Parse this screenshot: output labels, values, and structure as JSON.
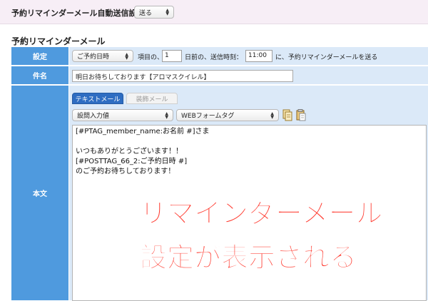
{
  "top": {
    "label": "予約リマインダーメール自動送信設定：",
    "select_value": "送る"
  },
  "section_title": "予約リマインダーメール",
  "rows": {
    "settings": {
      "label": "設定",
      "base_select": "ご予約日時",
      "text_before_days": "項目の、",
      "days_value": "1",
      "text_days_before": "日前の、送信時刻：",
      "time_value": "11:00",
      "text_after": "に、予約リマインダーメールを送る"
    },
    "subject": {
      "label": "件名",
      "value": "明日お待ちしております【アロマスクイレル】"
    },
    "body": {
      "label": "本文",
      "tab_text": "テキストメール",
      "tab_html": "装飾メール",
      "insert_select": "設問入力値",
      "web_form_select": "WEBフォームタグ",
      "lines": [
        "[#PTAG_member_name:お名前 #]さま",
        "",
        "いつもありがとうございます！！",
        "[#POSTTAG_66_2:ご予約日時 #]",
        "のご予約お待ちしております！"
      ]
    }
  },
  "overlay": {
    "line1": "リマインダーメール",
    "line2": "設定が表示される",
    "color": "#ff3b30"
  },
  "colors": {
    "label_bg": "#4f9ade",
    "value_bg": "#dbe9f8",
    "top_bg": "#f7eef6",
    "tab_active": "#2e6dc2"
  },
  "icons": [
    "copy-icon",
    "paste-icon",
    "select-arrows-icon"
  ]
}
